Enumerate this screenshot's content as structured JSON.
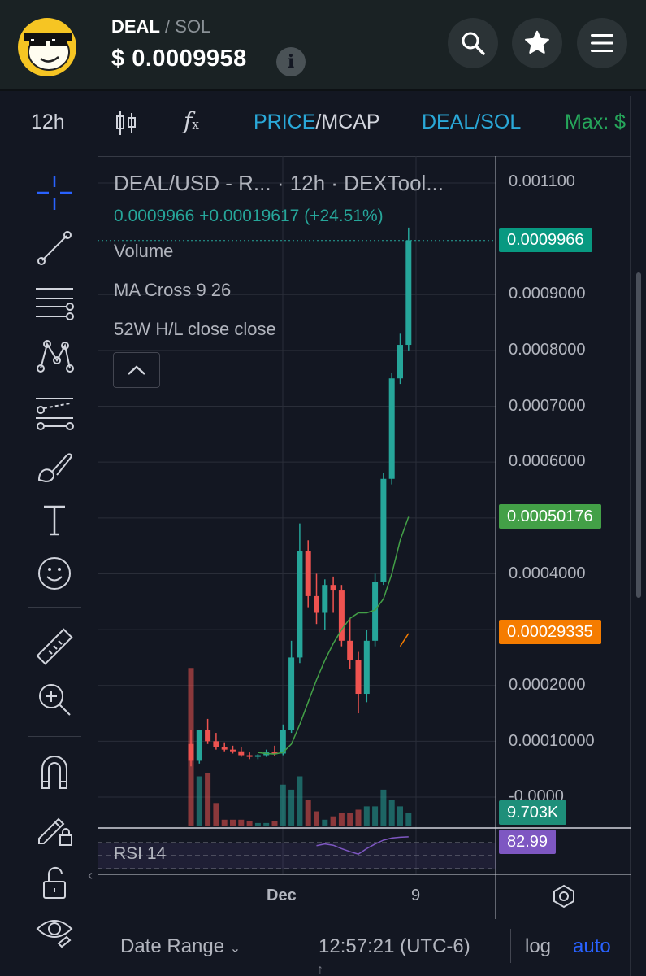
{
  "header": {
    "base_symbol": "DEAL",
    "separator": "/",
    "quote_symbol": "SOL",
    "currency_sign": "$",
    "price": "0.0009958",
    "info_glyph": "i",
    "icons": [
      "token-logo",
      "search-icon",
      "star-icon",
      "menu-icon",
      "info-icon"
    ]
  },
  "toolbar": {
    "interval": "12h",
    "price_label": "PRICE",
    "slash": "/",
    "mcap_label": "MCAP",
    "pair_label": "DEAL/SOL",
    "max_label": "Max: $"
  },
  "tools": [
    "crosshair-icon",
    "trend-line-icon",
    "fib-retracement-icon",
    "pattern-icon",
    "prediction-icon",
    "brush-icon",
    "text-icon",
    "emoji-icon",
    "ruler-icon",
    "zoom-in-icon",
    "magnet-icon",
    "lock-drawing-icon",
    "lock-icon",
    "eye-icon"
  ],
  "legend": {
    "title": "DEAL/USD - R...  · 12h · DEXTool...",
    "last": "0.0009966",
    "change": "+0.00019617",
    "change_pct": "(+24.51%)",
    "indicators": [
      "Volume",
      "MA Cross 9 26",
      "52W H/L close close"
    ]
  },
  "price_axis": {
    "ticks": [
      "0.001100",
      "0.0009000",
      "0.0008000",
      "0.0007000",
      "0.0006000",
      "0.0004000",
      "0.0002000",
      "0.00010000",
      "-0.0000"
    ],
    "last_price_tag": "0.0009966",
    "ma_tag": "0.00050176",
    "ma2_tag": "0.00029335",
    "volume_tag": "9.703K",
    "rsi_tag": "82.99",
    "colors": {
      "last": "#089981",
      "ma": "#43a047",
      "ma2": "#f57c00",
      "volume": "#1e8f7a",
      "rsi": "#7e57c2"
    }
  },
  "rsi": {
    "label": "RSI 14"
  },
  "time_axis": {
    "labels": [
      "Dec",
      "9"
    ]
  },
  "bottom": {
    "date_range": "Date Range",
    "time": "12:57:21 (UTC-6)",
    "log": "log",
    "auto": "auto"
  },
  "chart_data": {
    "type": "candlestick",
    "ylim": [
      0,
      0.0011
    ],
    "up_color": "#26a69a",
    "down_color": "#ef5350",
    "candles": [
      {
        "o": 9.5e-05,
        "h": 0.00012,
        "l": 5.5e-05,
        "c": 6.5e-05
      },
      {
        "o": 6.5e-05,
        "h": 0.00012,
        "l": 6e-05,
        "c": 0.00012
      },
      {
        "o": 0.00012,
        "h": 0.00014,
        "l": 9.5e-05,
        "c": 0.0001
      },
      {
        "o": 0.0001,
        "h": 0.000115,
        "l": 8.5e-05,
        "c": 9e-05
      },
      {
        "o": 9e-05,
        "h": 9.8e-05,
        "l": 8.2e-05,
        "c": 8.5e-05
      },
      {
        "o": 8.5e-05,
        "h": 9.2e-05,
        "l": 7.8e-05,
        "c": 8.2e-05
      },
      {
        "o": 8.2e-05,
        "h": 9e-05,
        "l": 7.2e-05,
        "c": 7.5e-05
      },
      {
        "o": 7.5e-05,
        "h": 8e-05,
        "l": 6.8e-05,
        "c": 7.2e-05
      },
      {
        "o": 7.2e-05,
        "h": 7.7e-05,
        "l": 6.8e-05,
        "c": 7.5e-05
      },
      {
        "o": 7.5e-05,
        "h": 8.5e-05,
        "l": 7.2e-05,
        "c": 8e-05
      },
      {
        "o": 8e-05,
        "h": 9.2e-05,
        "l": 7.4e-05,
        "c": 7.8e-05
      },
      {
        "o": 7.8e-05,
        "h": 0.00013,
        "l": 7.5e-05,
        "c": 0.00012
      },
      {
        "o": 0.00012,
        "h": 0.00028,
        "l": 0.000115,
        "c": 0.00025
      },
      {
        "o": 0.00025,
        "h": 0.00049,
        "l": 0.00024,
        "c": 0.00044
      },
      {
        "o": 0.00044,
        "h": 0.00046,
        "l": 0.00034,
        "c": 0.00036
      },
      {
        "o": 0.00036,
        "h": 0.0004,
        "l": 0.00031,
        "c": 0.00033
      },
      {
        "o": 0.00033,
        "h": 0.00039,
        "l": 0.0003,
        "c": 0.00038
      },
      {
        "o": 0.00038,
        "h": 0.000395,
        "l": 0.00033,
        "c": 0.00037
      },
      {
        "o": 0.00037,
        "h": 0.00038,
        "l": 0.00027,
        "c": 0.00028
      },
      {
        "o": 0.00028,
        "h": 0.00032,
        "l": 0.00023,
        "c": 0.000245
      },
      {
        "o": 0.000245,
        "h": 0.00026,
        "l": 0.00015,
        "c": 0.000185
      },
      {
        "o": 0.000185,
        "h": 0.0003,
        "l": 0.00017,
        "c": 0.00028
      },
      {
        "o": 0.00028,
        "h": 0.0004,
        "l": 0.00027,
        "c": 0.000385
      },
      {
        "o": 0.000385,
        "h": 0.00058,
        "l": 0.00038,
        "c": 0.00057
      },
      {
        "o": 0.00057,
        "h": 0.00076,
        "l": 0.00056,
        "c": 0.00075
      },
      {
        "o": 0.00075,
        "h": 0.00083,
        "l": 0.00074,
        "c": 0.00081
      },
      {
        "o": 0.00081,
        "h": 0.00102,
        "l": 0.0008,
        "c": 0.000997
      }
    ],
    "ma_fast": [
      null,
      null,
      null,
      null,
      null,
      null,
      null,
      null,
      8e-05,
      7.8e-05,
      7.7e-05,
      8e-05,
      9.5e-05,
      0.00013,
      0.00017,
      0.00021,
      0.000245,
      0.000275,
      0.0003,
      0.00032,
      0.00033,
      0.00033,
      0.000335,
      0.000355,
      0.0004,
      0.00046,
      0.000502
    ],
    "ma_slow": [
      null,
      null,
      null,
      null,
      null,
      null,
      null,
      null,
      null,
      null,
      null,
      null,
      null,
      null,
      null,
      null,
      null,
      null,
      null,
      null,
      null,
      null,
      null,
      null,
      null,
      0.00027,
      0.000293
    ],
    "volume": [
      0.95,
      0.3,
      0.32,
      0.14,
      0.04,
      0.04,
      0.04,
      0.03,
      0.02,
      0.02,
      0.03,
      0.25,
      0.22,
      0.3,
      0.16,
      0.09,
      0.04,
      0.06,
      0.08,
      0.08,
      0.1,
      0.12,
      0.12,
      0.22,
      0.16,
      0.12,
      0.08
    ],
    "volume_up": [
      false,
      true,
      false,
      false,
      false,
      false,
      false,
      false,
      true,
      true,
      false,
      true,
      true,
      true,
      false,
      false,
      true,
      false,
      false,
      false,
      false,
      true,
      true,
      true,
      true,
      true,
      true
    ],
    "rsi": [
      null,
      null,
      null,
      null,
      null,
      null,
      null,
      null,
      null,
      null,
      null,
      null,
      null,
      null,
      null,
      0.62,
      0.66,
      0.63,
      0.55,
      0.48,
      0.42,
      0.55,
      0.66,
      0.75,
      0.8,
      0.82,
      0.83
    ]
  }
}
